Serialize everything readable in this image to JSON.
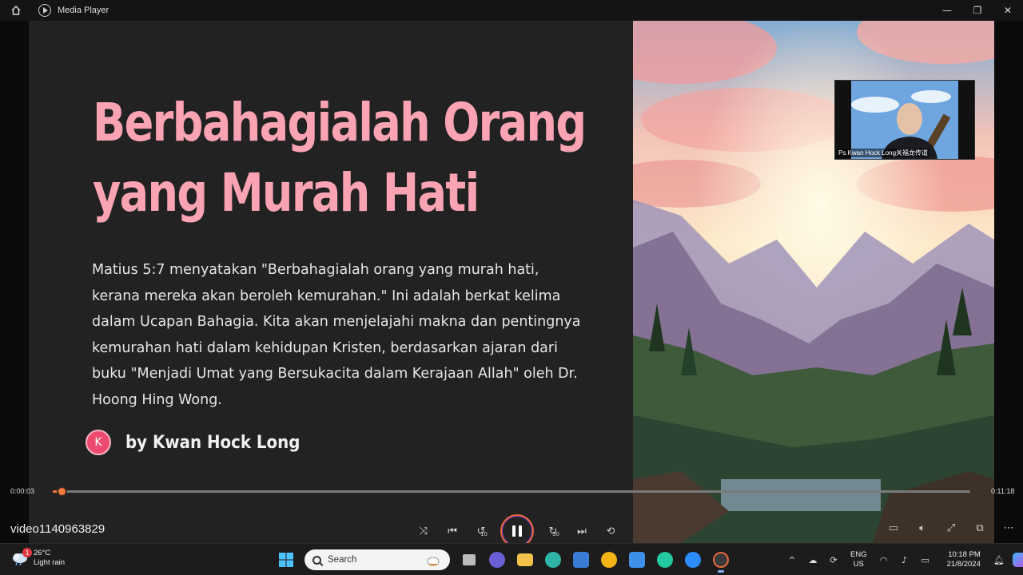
{
  "window": {
    "title": "Media Player",
    "controls": [
      "minimize",
      "maximize",
      "close"
    ]
  },
  "slide": {
    "title_line1": "Berbahagialah Orang",
    "title_line2": "yang Murah Hati",
    "body": "Matius 5:7 menyatakan \"Berbahagialah orang yang murah hati, kerana mereka akan beroleh kemurahan.\" Ini adalah berkat kelima dalam Ucapan Bahagia. Kita akan menjelajahi makna dan pentingnya kemurahan hati dalam kehidupan Kristen, berdasarkan ajaran dari buku \"Menjadi Umat yang Bersukacita dalam Kerajaan Allah\" oleh Dr. Hoong Hing Wong.",
    "author_initial": "K",
    "author": "by Kwan Hock Long",
    "title_color": "#f9a3b3"
  },
  "camera": {
    "caption": "Ps.Kwan Hock Long关福龙传道"
  },
  "player": {
    "current_time": "0:00:03",
    "total_time": "0:11:18",
    "progress_fraction": 0.01,
    "filename": "video1140963829",
    "skip_back_seconds": "10",
    "skip_forward_seconds": "30",
    "accent_color": "#f37a3b"
  },
  "taskbar": {
    "weather_temp": "26°C",
    "weather_desc": "Light rain",
    "weather_badge": "1",
    "search_placeholder": "Search",
    "lang_line1": "ENG",
    "lang_line2": "US",
    "time": "10:18 PM",
    "date": "21/8/2024"
  }
}
